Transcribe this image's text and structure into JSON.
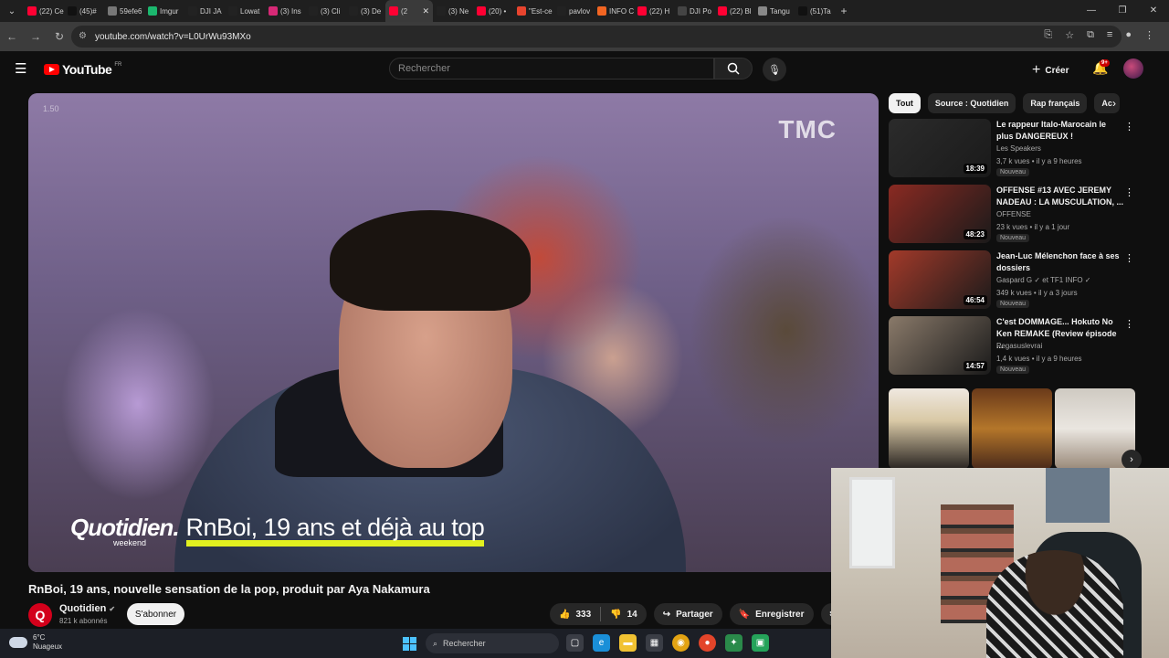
{
  "browser": {
    "tabs": [
      {
        "label": "(22) Ce",
        "color": "#ff0033"
      },
      {
        "label": "(45)#",
        "color": "#111111"
      },
      {
        "label": "59efe6",
        "color": "#777777"
      },
      {
        "label": "Imgur",
        "color": "#1bb76e"
      },
      {
        "label": "DJI JA",
        "color": "#222222"
      },
      {
        "label": "Lowat",
        "color": "#222222"
      },
      {
        "label": "(3) Ins",
        "color": "#d62976"
      },
      {
        "label": "(3) Cli",
        "color": "#222222"
      },
      {
        "label": "(3) De",
        "color": "#222222"
      },
      {
        "label": "(2",
        "color": "#ff0033"
      },
      {
        "label": "(3) Ne",
        "color": "#222222"
      },
      {
        "label": "(20) •",
        "color": "#ff0033"
      },
      {
        "label": "\"Est-ce",
        "color": "#e8442e"
      },
      {
        "label": "pavlov",
        "color": "#222222"
      },
      {
        "label": "INFO C",
        "color": "#f26522"
      },
      {
        "label": "(22) H",
        "color": "#ff0033"
      },
      {
        "label": "DJI Po",
        "color": "#444444"
      },
      {
        "label": "(22) Bl",
        "color": "#ff0033"
      },
      {
        "label": "Tangu",
        "color": "#888888"
      },
      {
        "label": "(51)Ta",
        "color": "#111111"
      }
    ],
    "active_tab_index": 9,
    "url": "youtube.com/watch?v=L0UrWu93MXo"
  },
  "youtube": {
    "logo_text": "YouTube",
    "country": "FR",
    "search_placeholder": "Rechercher",
    "create_label": "Créer",
    "notification_count": "9+"
  },
  "video": {
    "network_watermark": "TMC",
    "corner_text": "1.50",
    "caption_brand": "Quotidien.",
    "caption_sub": "weekend",
    "caption_headline": "RnBoi, 19 ans et déjà au top",
    "title": "RnBoi, 19 ans, nouvelle sensation de la pop, produit par Aya Nakamura",
    "channel": "Quotidien",
    "channel_initial": "Q",
    "subscribers": "821 k abonnés",
    "subscribe_label": "S'abonner",
    "likes": "333",
    "dislikes": "14",
    "share_label": "Partager",
    "save_label": "Enregistrer"
  },
  "chips": [
    "Tout",
    "Source : Quotidien",
    "Rap français",
    "Ac"
  ],
  "recommendations": [
    {
      "title": "Le rappeur Italo-Marocain le plus DANGEREUX !",
      "channel": "Les Speakers",
      "meta": "3,7 k vues • il y a 9 heures",
      "badge": "Nouveau",
      "duration": "18:39",
      "thumb_color": "#2b2b2b"
    },
    {
      "title": "OFFENSE #13 AVEC JEREMY NADEAU : LA MUSCULATION, ...",
      "channel": "OFFENSE",
      "meta": "23 k vues • il y a 1 jour",
      "badge": "Nouveau",
      "duration": "48:23",
      "thumb_color": "#8a2a22"
    },
    {
      "title": "Jean-Luc Mélenchon face à ses dossiers",
      "channel": "Gaspard G ✓ et TF1 INFO ✓",
      "meta": "349 k vues • il y a 3 jours",
      "badge": "Nouveau",
      "duration": "46:54",
      "thumb_color": "#a33a2a"
    },
    {
      "title": "C'est DOMMAGE... Hokuto No Ken REMAKE (Review épisode ...",
      "channel": "Pegasuslevrai",
      "meta": "1,4 k vues • il y a 9 heures",
      "badge": "Nouveau",
      "duration": "14:57",
      "thumb_color": "#8a7a6a"
    }
  ],
  "taskbar": {
    "temperature": "6°C",
    "weather": "Nuageux",
    "search_label": "Rechercher"
  }
}
